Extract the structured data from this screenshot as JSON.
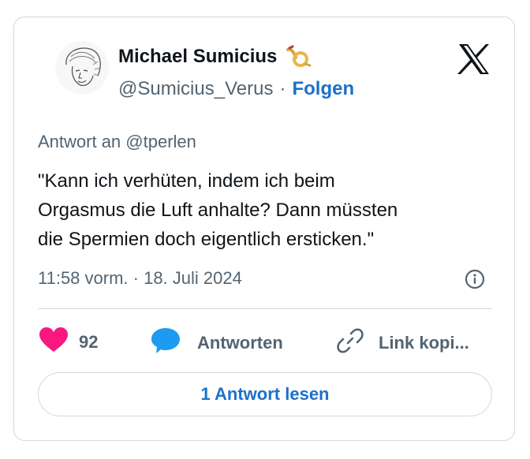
{
  "author": {
    "name": "Michael Sumicius",
    "handle": "@Sumicius_Verus",
    "separator": "·",
    "follow_label": "Folgen",
    "avatar_icon": "sketch-face-avatar",
    "badge_icon": "horn-emoji-icon"
  },
  "brand": {
    "logo_icon": "x-logo-icon"
  },
  "tweet": {
    "reply_to": "Antwort an @tperlen",
    "text": "\"Kann ich verhüten, indem ich beim\nOrgasmus die Luft anhalte? Dann müssten\ndie Spermien doch eigentlich ersticken.\"",
    "timestamp": "11:58 vorm. · 18. Juli 2024"
  },
  "actions": {
    "like_count": "92",
    "reply_label": "Antworten",
    "link_label": "Link kopi..."
  },
  "footer": {
    "read_replies_label": "1 Antwort lesen"
  },
  "colors": {
    "accent": "#1d70c9",
    "like": "#f91880",
    "reply_bubble": "#1d9bf0",
    "muted": "#536471"
  }
}
